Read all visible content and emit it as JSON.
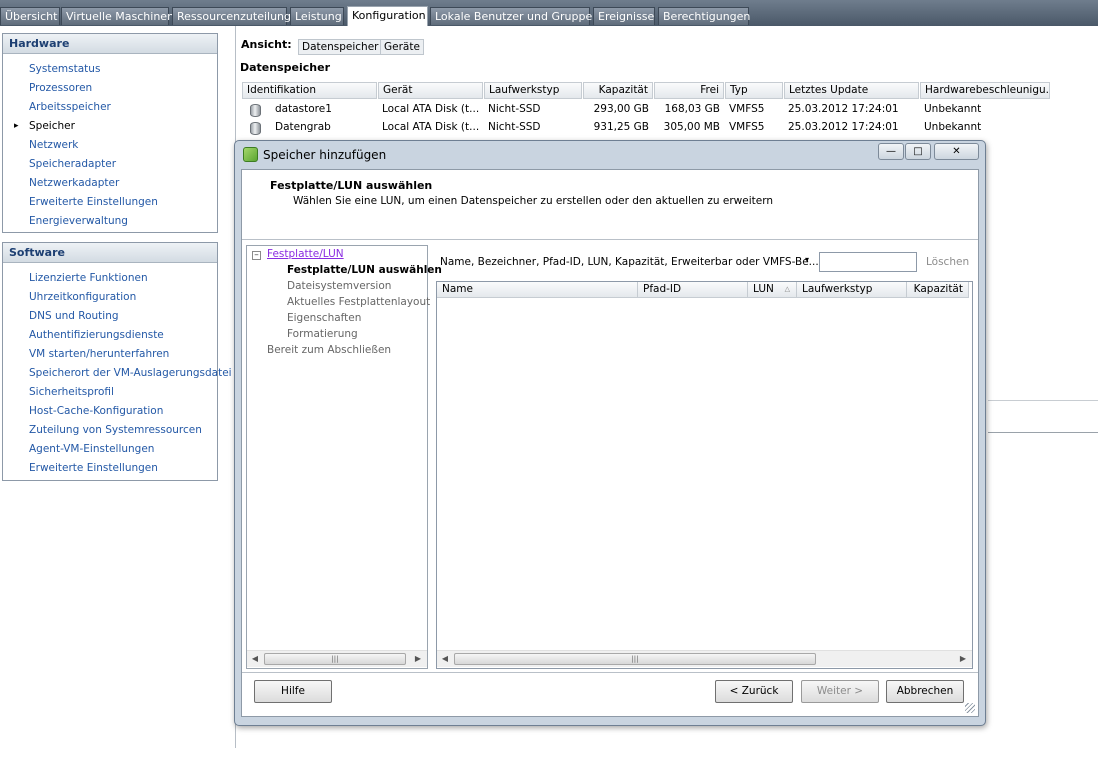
{
  "tabs": [
    {
      "label": "Übersicht",
      "active": false
    },
    {
      "label": "Virtuelle Maschinen",
      "active": false
    },
    {
      "label": "Ressourcenzuteilung",
      "active": false
    },
    {
      "label": "Leistung",
      "active": false
    },
    {
      "label": "Konfiguration",
      "active": true
    },
    {
      "label": "Lokale Benutzer und Gruppen",
      "active": false
    },
    {
      "label": "Ereignisse",
      "active": false
    },
    {
      "label": "Berechtigungen",
      "active": false
    }
  ],
  "hardware": {
    "title": "Hardware",
    "items": [
      "Systemstatus",
      "Prozessoren",
      "Arbeitsspeicher",
      "Speicher",
      "Netzwerk",
      "Speicheradapter",
      "Netzwerkadapter",
      "Erweiterte Einstellungen",
      "Energieverwaltung"
    ],
    "selected": "Speicher"
  },
  "software": {
    "title": "Software",
    "items": [
      "Lizenzierte Funktionen",
      "Uhrzeitkonfiguration",
      "DNS und Routing",
      "Authentifizierungsdienste",
      "VM starten/herunterfahren",
      "Speicherort der VM-Auslagerungsdatei",
      "Sicherheitsprofil",
      "Host-Cache-Konfiguration",
      "Zuteilung von Systemressourcen",
      "Agent-VM-Einstellungen",
      "Erweiterte Einstellungen"
    ]
  },
  "view": {
    "label": "Ansicht:",
    "datastores_btn": "Datenspeicher",
    "devices_btn": "Geräte"
  },
  "datastores": {
    "title": "Datenspeicher",
    "columns": [
      "Identifikation",
      "Gerät",
      "Laufwerkstyp",
      "Kapazität",
      "Frei",
      "Typ",
      "Letztes Update",
      "Hardwarebeschleunigu..."
    ],
    "rows": [
      [
        "datastore1",
        "Local ATA Disk (t...",
        "Nicht-SSD",
        "293,00 GB",
        "168,03 GB",
        "VMFS5",
        "25.03.2012 17:24:01",
        "Unbekannt"
      ],
      [
        "Datengrab",
        "Local ATA Disk (t...",
        "Nicht-SSD",
        "931,25 GB",
        "305,00 MB",
        "VMFS5",
        "25.03.2012 17:24:01",
        "Unbekannt"
      ]
    ]
  },
  "dialog": {
    "title": "Speicher hinzufügen",
    "header_title": "Festplatte/LUN auswählen",
    "header_subtitle": "Wählen Sie eine LUN, um einen Datenspeicher zu erstellen oder den aktuellen zu erweitern",
    "steps": {
      "group": "Festplatte/LUN",
      "current": "Festplatte/LUN auswählen",
      "substeps": [
        "Dateisystemversion",
        "Aktuelles Festplattenlayout",
        "Eigenschaften",
        "Formatierung"
      ],
      "final": "Bereit zum Abschließen"
    },
    "filter_label": "Name, Bezeichner, Pfad-ID, LUN, Kapazität, Erweiterbar oder VMFS-Be...",
    "filter_value": "",
    "clear_label": "Löschen",
    "lun_columns": [
      "Name",
      "Pfad-ID",
      "LUN",
      "Laufwerkstyp",
      "Kapazität"
    ],
    "lun_sort_column": "LUN",
    "buttons": {
      "help": "Hilfe",
      "back": "< Zurück",
      "next": "Weiter >",
      "cancel": "Abbrechen"
    }
  },
  "colors": {
    "link": "#2358a6",
    "tabbar": "#5a6878",
    "dialog_frame": "#c9d4e0"
  }
}
